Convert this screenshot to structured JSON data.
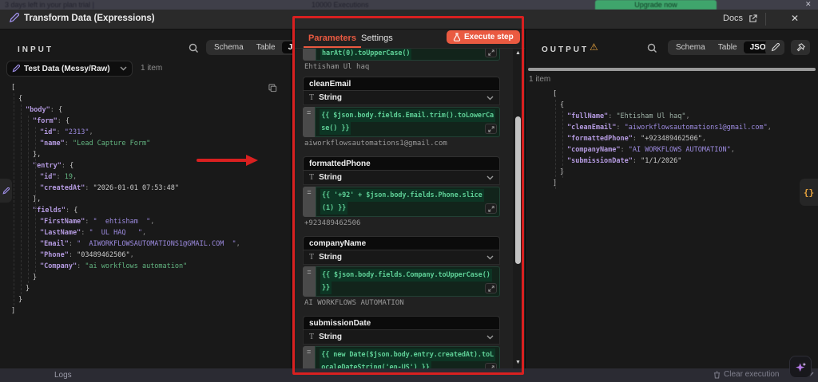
{
  "accent_color": "#ea5a41",
  "annotation_color": "#d92020",
  "background_bar": {
    "trial_text": "3 days left in your plan trial  |",
    "executions_text": "10000 Executions",
    "upgrade_label": "Upgrade now",
    "close_label": "✕"
  },
  "modal": {
    "title": "Transform Data (Expressions)",
    "docs_label": "Docs",
    "close_label": "✕"
  },
  "input_panel": {
    "title": "INPUT",
    "tabs": [
      "Schema",
      "Table",
      "JSON"
    ],
    "active_tab": "JSON",
    "source_selector_label": "Test Data (Messy/Raw)",
    "items_count": "1 item",
    "json_lines": [
      {
        "i": 0,
        "t": [
          [
            "[",
            "brace"
          ]
        ]
      },
      {
        "i": 1,
        "t": [
          [
            "{",
            "brace"
          ]
        ]
      },
      {
        "i": 2,
        "t": [
          [
            "\"body\"",
            "key"
          ],
          [
            ": ",
            "punc"
          ],
          [
            "{",
            "brace"
          ]
        ]
      },
      {
        "i": 3,
        "t": [
          [
            "\"form\"",
            "key"
          ],
          [
            ": ",
            "punc"
          ],
          [
            "{",
            "brace"
          ]
        ]
      },
      {
        "i": 4,
        "t": [
          [
            "\"id\"",
            "key"
          ],
          [
            ": ",
            "punc"
          ],
          [
            "\"2313\"",
            "vstr"
          ],
          [
            ",",
            "punc"
          ]
        ]
      },
      {
        "i": 4,
        "t": [
          [
            "\"name\"",
            "key"
          ],
          [
            ": ",
            "punc"
          ],
          [
            "\"Lead Capture Form\"",
            "gstr"
          ]
        ]
      },
      {
        "i": 3,
        "t": [
          [
            "},",
            "brace"
          ]
        ]
      },
      {
        "i": 3,
        "t": [
          [
            "\"entry\"",
            "key"
          ],
          [
            ": ",
            "punc"
          ],
          [
            "{",
            "brace"
          ]
        ]
      },
      {
        "i": 4,
        "t": [
          [
            "\"id\"",
            "key"
          ],
          [
            ": ",
            "punc"
          ],
          [
            "19",
            "num"
          ],
          [
            ",",
            "punc"
          ]
        ]
      },
      {
        "i": 4,
        "t": [
          [
            "\"createdAt\"",
            "key"
          ],
          [
            ": ",
            "punc"
          ],
          [
            "\"2026-01-01 07:53:48\"",
            "wstr"
          ]
        ]
      },
      {
        "i": 3,
        "t": [
          [
            "},",
            "brace"
          ]
        ]
      },
      {
        "i": 3,
        "t": [
          [
            "\"fields\"",
            "key"
          ],
          [
            ": ",
            "punc"
          ],
          [
            "{",
            "brace"
          ]
        ]
      },
      {
        "i": 4,
        "t": [
          [
            "\"FirstName\"",
            "key"
          ],
          [
            ": ",
            "punc"
          ],
          [
            "\"  ehtisham  \"",
            "vstr"
          ],
          [
            ",",
            "punc"
          ]
        ]
      },
      {
        "i": 4,
        "t": [
          [
            "\"LastName\"",
            "key"
          ],
          [
            ": ",
            "punc"
          ],
          [
            "\"  UL HAQ   \"",
            "vstr"
          ],
          [
            ",",
            "punc"
          ]
        ]
      },
      {
        "i": 4,
        "t": [
          [
            "\"Email\"",
            "key"
          ],
          [
            ": ",
            "punc"
          ],
          [
            "\"  AIWORKFLOWSAUTOMATIONS1@GMAIL.COM  \"",
            "vstr"
          ],
          [
            ",",
            "punc"
          ]
        ]
      },
      {
        "i": 4,
        "t": [
          [
            "\"Phone\"",
            "key"
          ],
          [
            ": ",
            "punc"
          ],
          [
            "\"03489462506\"",
            "wstr"
          ],
          [
            ",",
            "punc"
          ]
        ]
      },
      {
        "i": 4,
        "t": [
          [
            "\"Company\"",
            "key"
          ],
          [
            ": ",
            "punc"
          ],
          [
            "\"ai workflows automation\"",
            "gstr"
          ]
        ]
      },
      {
        "i": 3,
        "t": [
          [
            "}",
            "brace"
          ]
        ]
      },
      {
        "i": 2,
        "t": [
          [
            "}",
            "brace"
          ]
        ]
      },
      {
        "i": 1,
        "t": [
          [
            "}",
            "brace"
          ]
        ]
      },
      {
        "i": 0,
        "t": [
          [
            "]",
            "brace"
          ]
        ]
      }
    ]
  },
  "params_panel": {
    "tab_parameters": "Parameters",
    "tab_settings": "Settings",
    "execute_button_label": "Execute step",
    "partial_field": {
      "code": "harAt(0).toUpperCase()",
      "result": "Ehtisham Ul haq"
    },
    "fields": [
      {
        "name": "cleanEmail",
        "type": "String",
        "expr_lines": [
          "{{ $json.body.fields.Email.trim().toLowerCa",
          "se() }}"
        ],
        "result": "aiworkflowsautomations1@gmail.com"
      },
      {
        "name": "formattedPhone",
        "type": "String",
        "expr_lines": [
          "{{ '+92' + $json.body.fields.Phone.slice",
          "(1) }}"
        ],
        "result": "+923489462506"
      },
      {
        "name": "companyName",
        "type": "String",
        "expr_lines": [
          "{{ $json.body.fields.Company.toUpperCase()",
          "}}"
        ],
        "result": "AI WORKFLOWS AUTOMATION"
      },
      {
        "name": "submissionDate",
        "type": "String",
        "expr_lines": [
          "{{ new Date($json.body.entry.createdAt).toL",
          "ocaleDateString('en-US') }}"
        ],
        "result": null
      }
    ]
  },
  "output_panel": {
    "title": "OUTPUT",
    "warning_icon": "⚠",
    "tabs": [
      "Schema",
      "Table",
      "JSON"
    ],
    "active_tab": "JSON",
    "items_count": "1 item",
    "json_lines": [
      {
        "i": 0,
        "t": [
          [
            "[",
            "brace"
          ]
        ]
      },
      {
        "i": 1,
        "t": [
          [
            "{",
            "brace"
          ]
        ]
      },
      {
        "i": 2,
        "t": [
          [
            "\"fullName\"",
            "key"
          ],
          [
            ": ",
            "punc"
          ],
          [
            "\"Ehtisham Ul haq\"",
            "pale"
          ],
          [
            ",",
            "punc"
          ]
        ]
      },
      {
        "i": 2,
        "t": [
          [
            "\"cleanEmail\"",
            "key"
          ],
          [
            ": ",
            "punc"
          ],
          [
            "\"aiworkflowsautomations1@gmail.com\"",
            "vstr"
          ],
          [
            ",",
            "punc"
          ]
        ]
      },
      {
        "i": 2,
        "t": [
          [
            "\"formattedPhone\"",
            "key"
          ],
          [
            ": ",
            "punc"
          ],
          [
            "\"+923489462506\"",
            "wstr"
          ],
          [
            ",",
            "punc"
          ]
        ]
      },
      {
        "i": 2,
        "t": [
          [
            "\"companyName\"",
            "key"
          ],
          [
            ": ",
            "punc"
          ],
          [
            "\"AI WORKFLOWS AUTOMATION\"",
            "vstr"
          ],
          [
            ",",
            "punc"
          ]
        ]
      },
      {
        "i": 2,
        "t": [
          [
            "\"submissionDate\"",
            "key"
          ],
          [
            ": ",
            "punc"
          ],
          [
            "\"1/1/2026\"",
            "wstr"
          ]
        ]
      },
      {
        "i": 1,
        "t": [
          [
            "}",
            "brace"
          ]
        ]
      },
      {
        "i": 0,
        "t": [
          [
            "]",
            "brace"
          ]
        ]
      }
    ]
  },
  "bottom_bar": {
    "logs_label": "Logs",
    "clear_execution_label": "Clear execution"
  },
  "edge_tabs": {
    "code_tab_label": "{}"
  }
}
